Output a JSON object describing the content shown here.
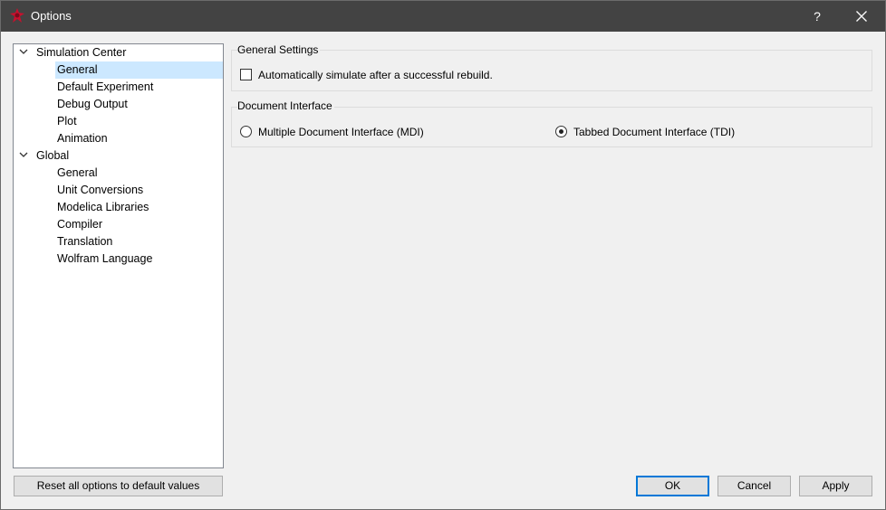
{
  "window": {
    "title": "Options",
    "help_label": "?"
  },
  "tree": {
    "groups": [
      {
        "label": "Simulation Center",
        "items": [
          "General",
          "Default Experiment",
          "Debug Output",
          "Plot",
          "Animation"
        ]
      },
      {
        "label": "Global",
        "items": [
          "General",
          "Unit Conversions",
          "Modelica Libraries",
          "Compiler",
          "Translation",
          "Wolfram Language"
        ]
      }
    ],
    "selected": "Simulation Center > General"
  },
  "general_settings": {
    "title": "General Settings",
    "auto_simulate_label": "Automatically simulate after a successful rebuild.",
    "auto_simulate_checked": false
  },
  "document_interface": {
    "title": "Document Interface",
    "mdi_label": "Multiple Document Interface (MDI)",
    "tdi_label": "Tabbed Document Interface (TDI)",
    "selected": "Tabbed Document Interface (TDI)"
  },
  "buttons": {
    "reset_label": "Reset all options to default values",
    "ok_label": "OK",
    "cancel_label": "Cancel",
    "apply_label": "Apply"
  },
  "colors": {
    "titlebar": "#434343",
    "selection": "#cce8ff",
    "default_button_border": "#0078d7"
  }
}
